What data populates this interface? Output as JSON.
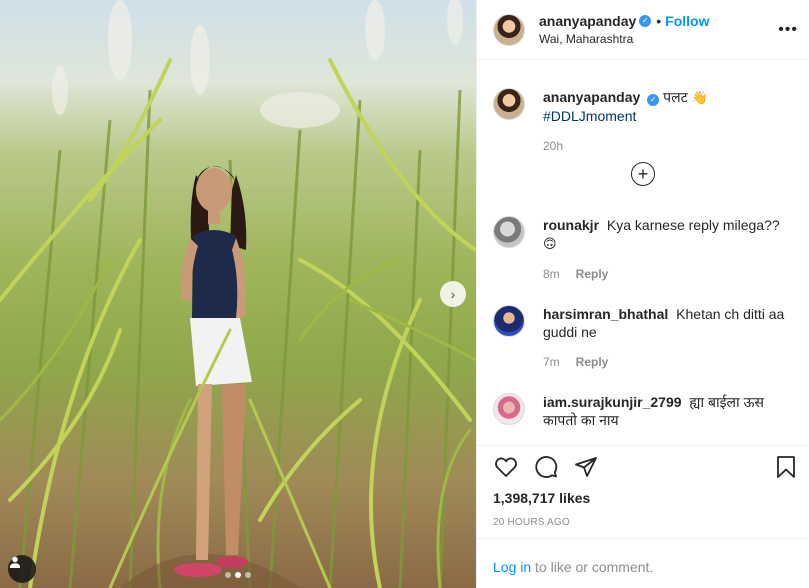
{
  "post": {
    "author": "ananyapanday",
    "location": "Wai, Maharashtra",
    "follow_label": "Follow",
    "bullet": "•",
    "more": "•••"
  },
  "caption": {
    "username": "ananyapanday",
    "text": "पलट",
    "emoji": "👋",
    "hashtag": "#DDLJmoment",
    "time": "20h"
  },
  "load_more": "+",
  "comments": [
    {
      "username": "rounakjr",
      "text": "Kya karnese reply milega??",
      "emoji": "🙃",
      "time": "8m",
      "reply": "Reply"
    },
    {
      "username": "harsimran_bhathal",
      "text": "Khetan ch ditti aa guddi ne",
      "time": "7m",
      "reply": "Reply"
    },
    {
      "username": "iam.surajkunjir_2799",
      "text": "ह्या बाईला ऊस कापतो का नाय"
    }
  ],
  "actions": {
    "likes": "1,398,717 likes",
    "time_ago": "20 HOURS AGO"
  },
  "login": {
    "link": "Log in",
    "rest": " to like or comment."
  },
  "carousel": {
    "slides": 3,
    "active": 1
  },
  "colors": {
    "link": "#0095f6",
    "verified": "#3897f0",
    "hashtag": "#00376b",
    "muted": "#8e8e8e"
  },
  "icons": [
    "verified-badge-icon",
    "more-options-icon",
    "heart-icon",
    "comment-icon",
    "share-icon",
    "bookmark-icon",
    "chevron-right-icon",
    "user-tag-icon",
    "plus-circle-icon"
  ]
}
